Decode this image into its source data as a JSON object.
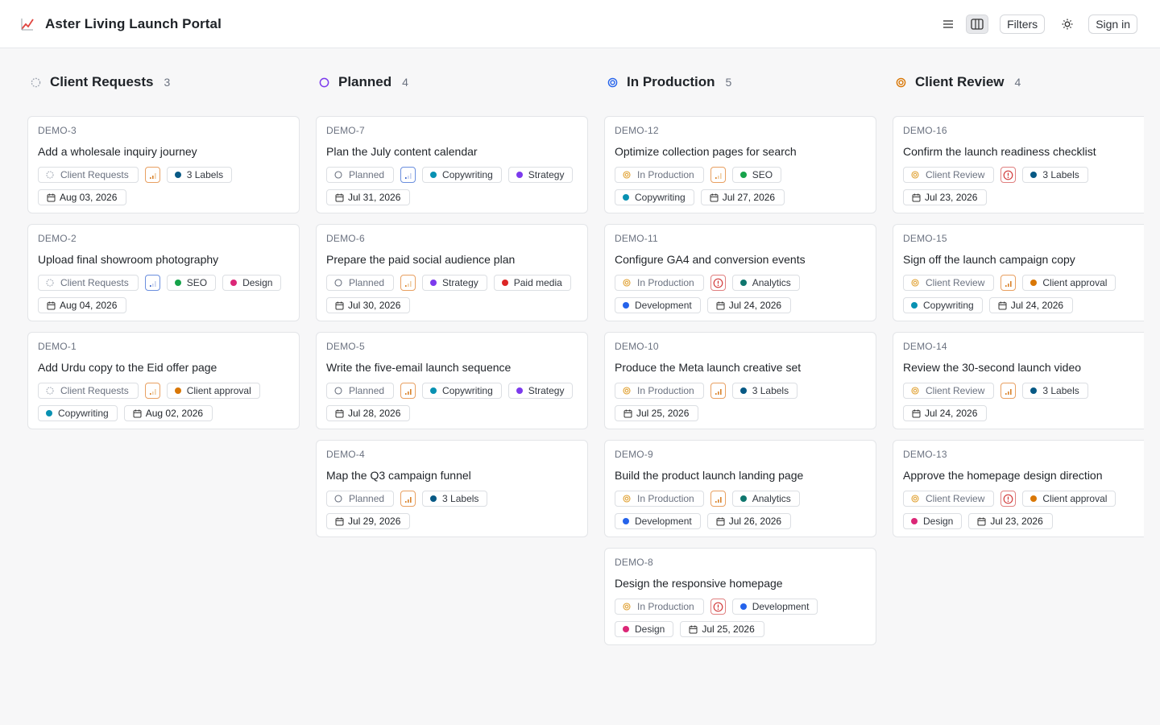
{
  "app": {
    "title": "Aster Living Launch Portal",
    "logo_icon": "chart-increasing-icon"
  },
  "toolbar": {
    "list_view_icon": "list-icon",
    "board_view_icon": "columns-icon",
    "filters_label": "Filters",
    "theme_icon": "sun-icon",
    "signin_label": "Sign in"
  },
  "colors": {
    "client_requests": "#9ca3af",
    "planned": "#7c3aed",
    "in_production": "#2563eb",
    "client_review": "#d97706",
    "seo": "#16a34a",
    "copywriting": "#0891b2",
    "strategy": "#7c3aed",
    "design": "#db2777",
    "paid_media": "#dc2626",
    "analytics": "#0f766e",
    "development": "#2563eb",
    "client_approval": "#d97706",
    "labels": "#075985"
  },
  "columns": [
    {
      "title": "Client Requests",
      "count": "3",
      "status": "client_requests",
      "cards": [
        {
          "id": "DEMO-3",
          "title": "Add a wholesale inquiry journey",
          "status_label": "Client Requests",
          "priority": "medium",
          "labels": [
            {
              "text": "3 Labels",
              "color": "labels"
            }
          ],
          "date": "Aug 03, 2026",
          "rows": [
            [
              0,
              1,
              2
            ],
            [
              3
            ]
          ]
        },
        {
          "id": "DEMO-2",
          "title": "Upload final showroom photography",
          "status_label": "Client Requests",
          "priority": "low",
          "labels": [
            {
              "text": "SEO",
              "color": "seo"
            },
            {
              "text": "Design",
              "color": "design"
            }
          ],
          "date": "Aug 04, 2026"
        },
        {
          "id": "DEMO-1",
          "title": "Add Urdu copy to the Eid offer page",
          "status_label": "Client Requests",
          "priority": "low-orange",
          "labels": [
            {
              "text": "Client approval",
              "color": "client_approval"
            },
            {
              "text": "Copywriting",
              "color": "copywriting"
            }
          ],
          "date": "Aug 02, 2026"
        }
      ]
    },
    {
      "title": "Planned",
      "count": "4",
      "status": "planned",
      "cards": [
        {
          "id": "DEMO-7",
          "title": "Plan the July content calendar",
          "status_label": "Planned",
          "priority": "low",
          "labels": [
            {
              "text": "Copywriting",
              "color": "copywriting"
            },
            {
              "text": "Strategy",
              "color": "strategy"
            }
          ],
          "date": "Jul 31, 2026"
        },
        {
          "id": "DEMO-6",
          "title": "Prepare the paid social audience plan",
          "status_label": "Planned",
          "priority": "low-orange",
          "labels": [
            {
              "text": "Strategy",
              "color": "strategy"
            },
            {
              "text": "Paid media",
              "color": "paid_media"
            }
          ],
          "date": "Jul 30, 2026"
        },
        {
          "id": "DEMO-5",
          "title": "Write the five-email launch sequence",
          "status_label": "Planned",
          "priority": "high",
          "labels": [
            {
              "text": "Copywriting",
              "color": "copywriting"
            },
            {
              "text": "Strategy",
              "color": "strategy"
            }
          ],
          "date": "Jul 28, 2026"
        },
        {
          "id": "DEMO-4",
          "title": "Map the Q3 campaign funnel",
          "status_label": "Planned",
          "priority": "high",
          "labels": [
            {
              "text": "3 Labels",
              "color": "labels"
            }
          ],
          "date": "Jul 29, 2026"
        }
      ]
    },
    {
      "title": "In Production",
      "count": "5",
      "status": "in_production",
      "cards": [
        {
          "id": "DEMO-12",
          "title": "Optimize collection pages for search",
          "status_label": "In Production",
          "priority": "low-orange",
          "labels": [
            {
              "text": "SEO",
              "color": "seo"
            },
            {
              "text": "Copywriting",
              "color": "copywriting"
            }
          ],
          "date": "Jul 27, 2026"
        },
        {
          "id": "DEMO-11",
          "title": "Configure GA4 and conversion events",
          "status_label": "In Production",
          "priority": "urgent",
          "labels": [
            {
              "text": "Analytics",
              "color": "analytics"
            },
            {
              "text": "Development",
              "color": "development"
            }
          ],
          "date": "Jul 24, 2026"
        },
        {
          "id": "DEMO-10",
          "title": "Produce the Meta launch creative set",
          "status_label": "In Production",
          "priority": "high",
          "labels": [
            {
              "text": "3 Labels",
              "color": "labels"
            }
          ],
          "date": "Jul 25, 2026"
        },
        {
          "id": "DEMO-9",
          "title": "Build the product launch landing page",
          "status_label": "In Production",
          "priority": "high",
          "labels": [
            {
              "text": "Analytics",
              "color": "analytics"
            },
            {
              "text": "Development",
              "color": "development"
            }
          ],
          "date": "Jul 26, 2026"
        },
        {
          "id": "DEMO-8",
          "title": "Design the responsive homepage",
          "status_label": "In Production",
          "priority": "urgent",
          "labels": [
            {
              "text": "Development",
              "color": "development"
            },
            {
              "text": "Design",
              "color": "design"
            }
          ],
          "date": "Jul 25, 2026"
        }
      ]
    },
    {
      "title": "Client Review",
      "count": "4",
      "status": "client_review",
      "cards": [
        {
          "id": "DEMO-16",
          "title": "Confirm the launch readiness checklist",
          "status_label": "Client Review",
          "priority": "urgent",
          "labels": [
            {
              "text": "3 Labels",
              "color": "labels"
            }
          ],
          "date": "Jul 23, 2026"
        },
        {
          "id": "DEMO-15",
          "title": "Sign off the launch campaign copy",
          "status_label": "Client Review",
          "priority": "high",
          "labels": [
            {
              "text": "Client approval",
              "color": "client_approval"
            },
            {
              "text": "Copywriting",
              "color": "copywriting"
            }
          ],
          "date": "Jul 24, 2026"
        },
        {
          "id": "DEMO-14",
          "title": "Review the 30-second launch video",
          "status_label": "Client Review",
          "priority": "high",
          "labels": [
            {
              "text": "3 Labels",
              "color": "labels"
            }
          ],
          "date": "Jul 24, 2026"
        },
        {
          "id": "DEMO-13",
          "title": "Approve the homepage design direction",
          "status_label": "Client Review",
          "priority": "urgent",
          "labels": [
            {
              "text": "Client approval",
              "color": "client_approval"
            },
            {
              "text": "Design",
              "color": "design"
            }
          ],
          "date": "Jul 23, 2026"
        }
      ]
    }
  ]
}
